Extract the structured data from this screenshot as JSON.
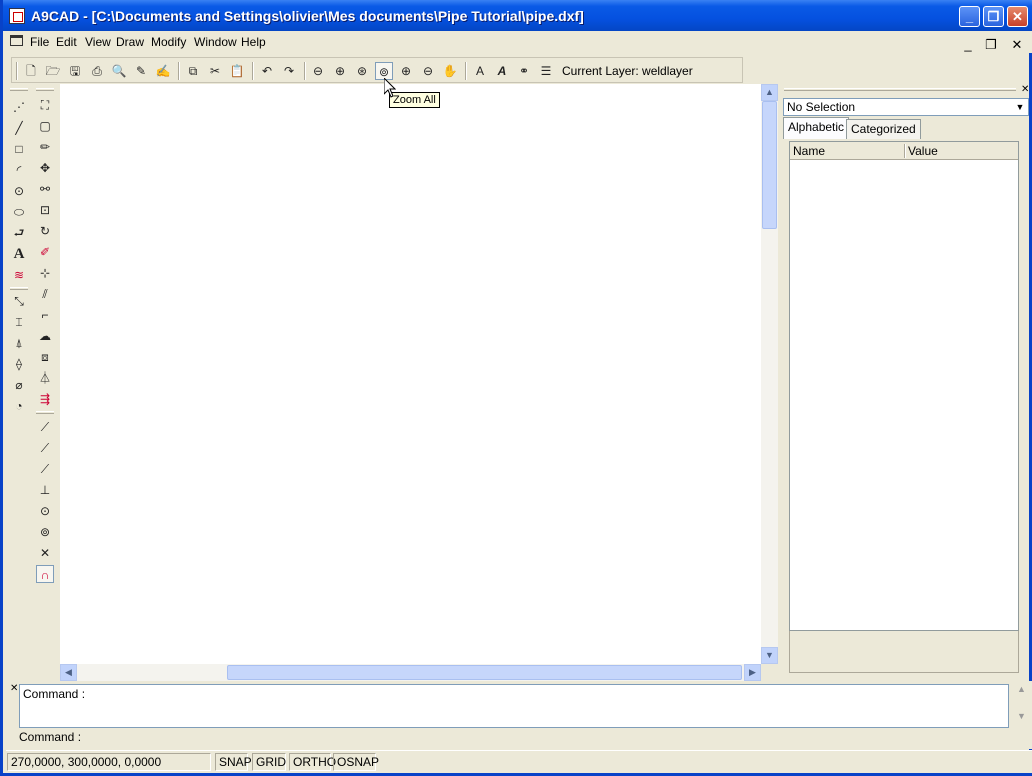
{
  "window": {
    "title": "A9CAD - [C:\\Documents and Settings\\olivier\\Mes documents\\Pipe Tutorial\\pipe.dxf]",
    "minimize": "_",
    "restore": "❐",
    "close": "✕"
  },
  "mdi": {
    "minimize": "_",
    "restore": "❐",
    "close": "✕"
  },
  "menu": {
    "items": [
      {
        "label": "File"
      },
      {
        "label": "Edit"
      },
      {
        "label": "View"
      },
      {
        "label": "Draw"
      },
      {
        "label": "Modify"
      },
      {
        "label": "Window"
      },
      {
        "label": "Help"
      }
    ]
  },
  "toolbar": {
    "current_layer": "Current Layer: weldlayer"
  },
  "tooltip": {
    "text": "Zoom All"
  },
  "properties": {
    "selection": "No Selection",
    "tabs": [
      {
        "label": "Alphabetic",
        "active": true
      },
      {
        "label": "Categorized",
        "active": false
      }
    ],
    "columns": [
      "Name",
      "Value"
    ]
  },
  "command": {
    "history": "Command :",
    "prompt": "Command :",
    "input_value": ""
  },
  "status": {
    "coordinates": "270,0000, 300,0000, 0,0000",
    "toggles": [
      "SNAP",
      "GRID",
      "ORTHO",
      "OSNAP"
    ]
  },
  "colors": {
    "titlebar": "#0551e0",
    "chrome": "#ece9d8",
    "canvas": "#ffffff",
    "tooltip": "#ffffe1"
  }
}
